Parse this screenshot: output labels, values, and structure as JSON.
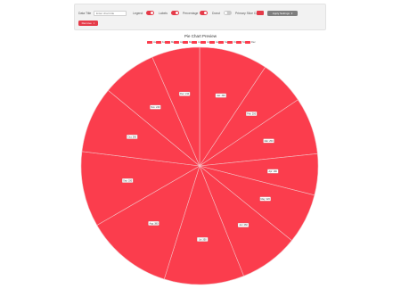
{
  "toolbar": {
    "data_title_label": "Data Title",
    "data_title_placeholder": "Enter chart title",
    "legend_label": "Legend",
    "labels_label": "Labels",
    "percentage_label": "Percentage",
    "donut_label": "Donut",
    "primary_color_label": "Primary Slice Color",
    "primary_color": "#e53b49",
    "apply_button_label": "Apply Settings",
    "remove_button_label": "Remove",
    "toggles": {
      "legend": true,
      "labels": true,
      "percentage": true,
      "donut": false
    }
  },
  "chart_data": {
    "type": "pie",
    "title": "Pie Chart Preview",
    "slice_color": "#fb3d4d",
    "border_color": "#f3c0c4",
    "categories": [
      "Jan",
      "Feb",
      "Mar",
      "Apr",
      "May",
      "Jun",
      "Jul",
      "Aug",
      "Sep",
      "Oct",
      "Nov",
      "Dec"
    ],
    "values": [
      300,
      200,
      250,
      180,
      220,
      260,
      350,
      380,
      330,
      290,
      240,
      210
    ],
    "data_labels": [
      "Jan: 300",
      "Feb: 200",
      "Mar: 250",
      "Apr: 180",
      "May: 220",
      "Jun: 260",
      "Jul: 350",
      "Aug: 380",
      "Sep: 330",
      "Oct: 290",
      "Nov: 240",
      "Dec: 210"
    ],
    "legend": {
      "placement": "top",
      "entries": [
        "Jan",
        "Feb",
        "Mar",
        "Apr",
        "May",
        "Jun",
        "Jul",
        "Aug",
        "Sep",
        "Oct",
        "Nov",
        "Dec"
      ]
    }
  }
}
